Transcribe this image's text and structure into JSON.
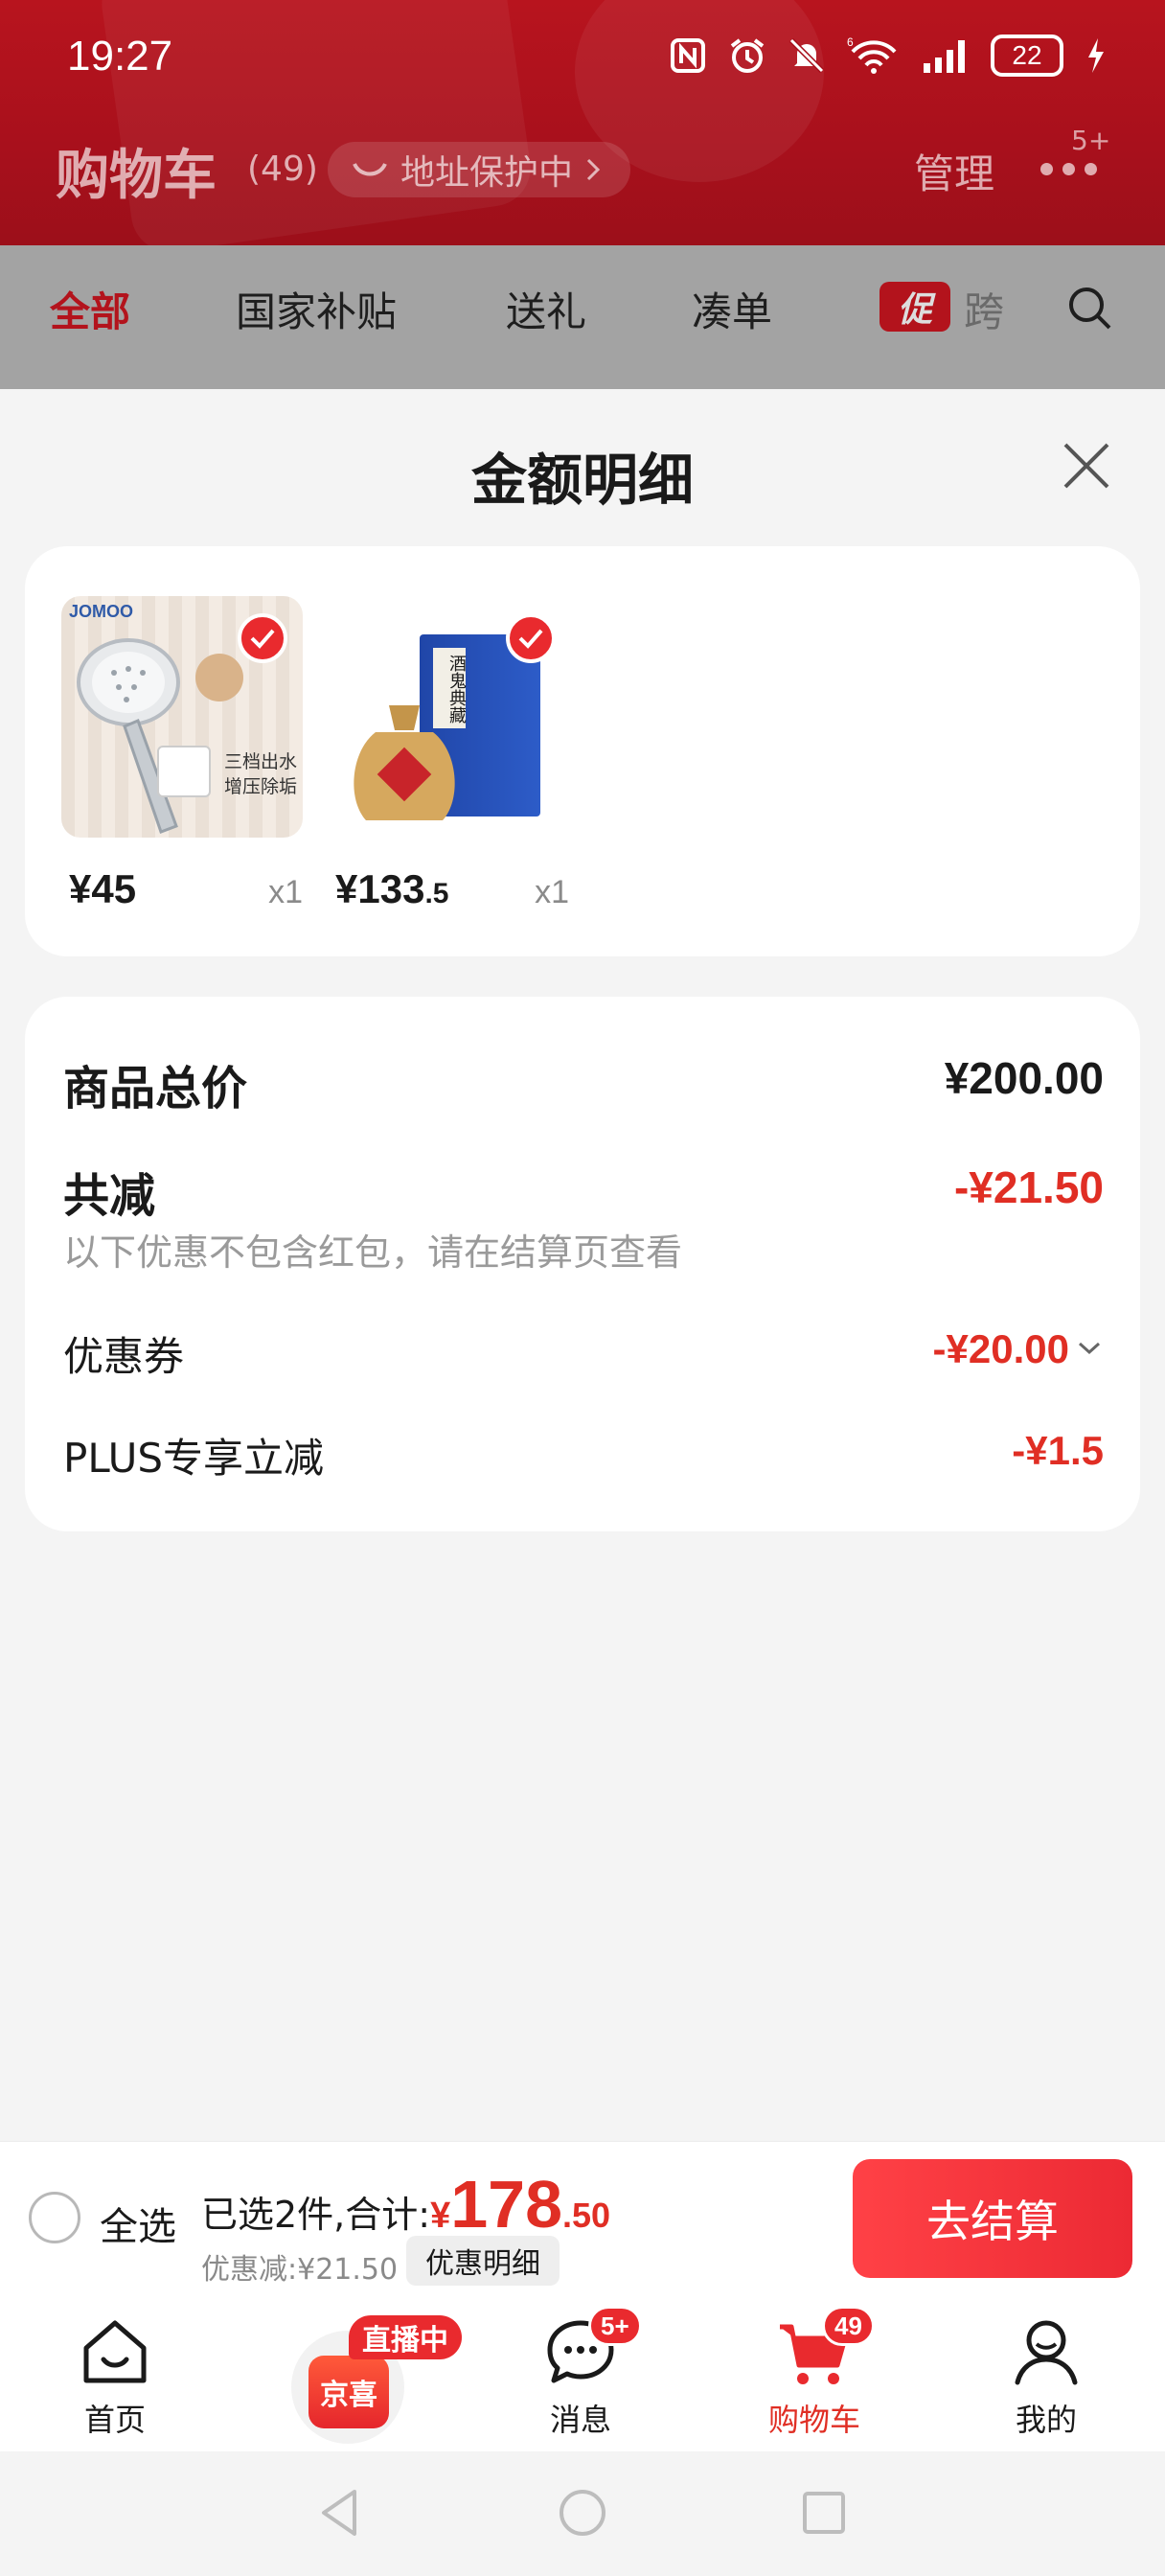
{
  "status_bar": {
    "time": "19:27",
    "network_label": "6",
    "battery": "22"
  },
  "header": {
    "title": "购物车",
    "count": "(49)",
    "address_protect": "地址保护中",
    "manage": "管理",
    "more_badge": "5+"
  },
  "tabs": {
    "items": [
      "全部",
      "国家补贴",
      "送礼",
      "凑单"
    ],
    "active_index": 0,
    "promo_badge": "促",
    "promo_next": "跨"
  },
  "sheet": {
    "title": "金额明细",
    "products": [
      {
        "brand": "JOMOO",
        "caption1": "三档出水",
        "caption2": "增压除垢",
        "price_int": "¥45",
        "price_dec": "",
        "qty": "x1"
      },
      {
        "brand": "",
        "caption1": "酒鬼典藏",
        "caption2": "",
        "price_int": "¥133",
        "price_dec": ".5",
        "qty": "x1"
      }
    ],
    "total_label": "商品总价",
    "total_value": "¥200.00",
    "reduce_label": "共减",
    "reduce_value": "-¥21.50",
    "note": "以下优惠不包含红包，请在结算页查看",
    "coupon_label": "优惠券",
    "coupon_value": "-¥20.00",
    "plus_label": "PLUS专享立减",
    "plus_value": "-¥1.5"
  },
  "checkout": {
    "select_all": "全选",
    "selected_prefix": "已选2件,合计:",
    "yen": "¥",
    "total_int": "178",
    "total_dec": ".50",
    "discount_text": "优惠减:¥21.50",
    "detail_button": "优惠明细",
    "go_button": "去结算"
  },
  "bottom_nav": {
    "home": "首页",
    "live_tag": "直播中",
    "live_bag_text": "京喜",
    "messages": "消息",
    "messages_badge": "5+",
    "cart": "购物车",
    "cart_badge": "49",
    "mine": "我的"
  },
  "colors": {
    "brand_red": "#e02e24",
    "header_red": "#b8141e",
    "checkout_button": "#ff4146"
  }
}
